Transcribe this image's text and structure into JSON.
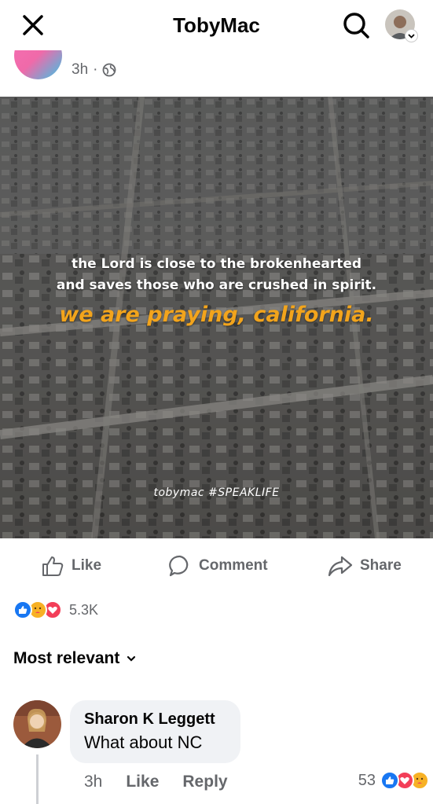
{
  "header": {
    "title": "TobyMac"
  },
  "post": {
    "time": "3h",
    "privacy_icon": "globe-icon",
    "image_text": {
      "line1": "the Lord is close to the brokenhearted",
      "line2": "and saves those who are crushed in spirit.",
      "line3": "we are praying, california.",
      "signature": "tobymac #SPEAKLIFE"
    }
  },
  "actions": {
    "like": "Like",
    "comment": "Comment",
    "share": "Share"
  },
  "reactions": {
    "types": [
      "like",
      "care",
      "love"
    ],
    "count": "5.3K"
  },
  "sort": {
    "label": "Most relevant"
  },
  "comment": {
    "author": "Sharon K Leggett",
    "text": "What about NC",
    "time": "3h",
    "like_label": "Like",
    "reply_label": "Reply",
    "reaction_count": "53",
    "reaction_types": [
      "like",
      "love",
      "care"
    ]
  },
  "colors": {
    "accent_blue": "#1877f2",
    "love_red": "#f33e58",
    "care_yellow": "#f7b125",
    "text_gray": "#65676b",
    "caption_orange": "#f2a41c"
  }
}
